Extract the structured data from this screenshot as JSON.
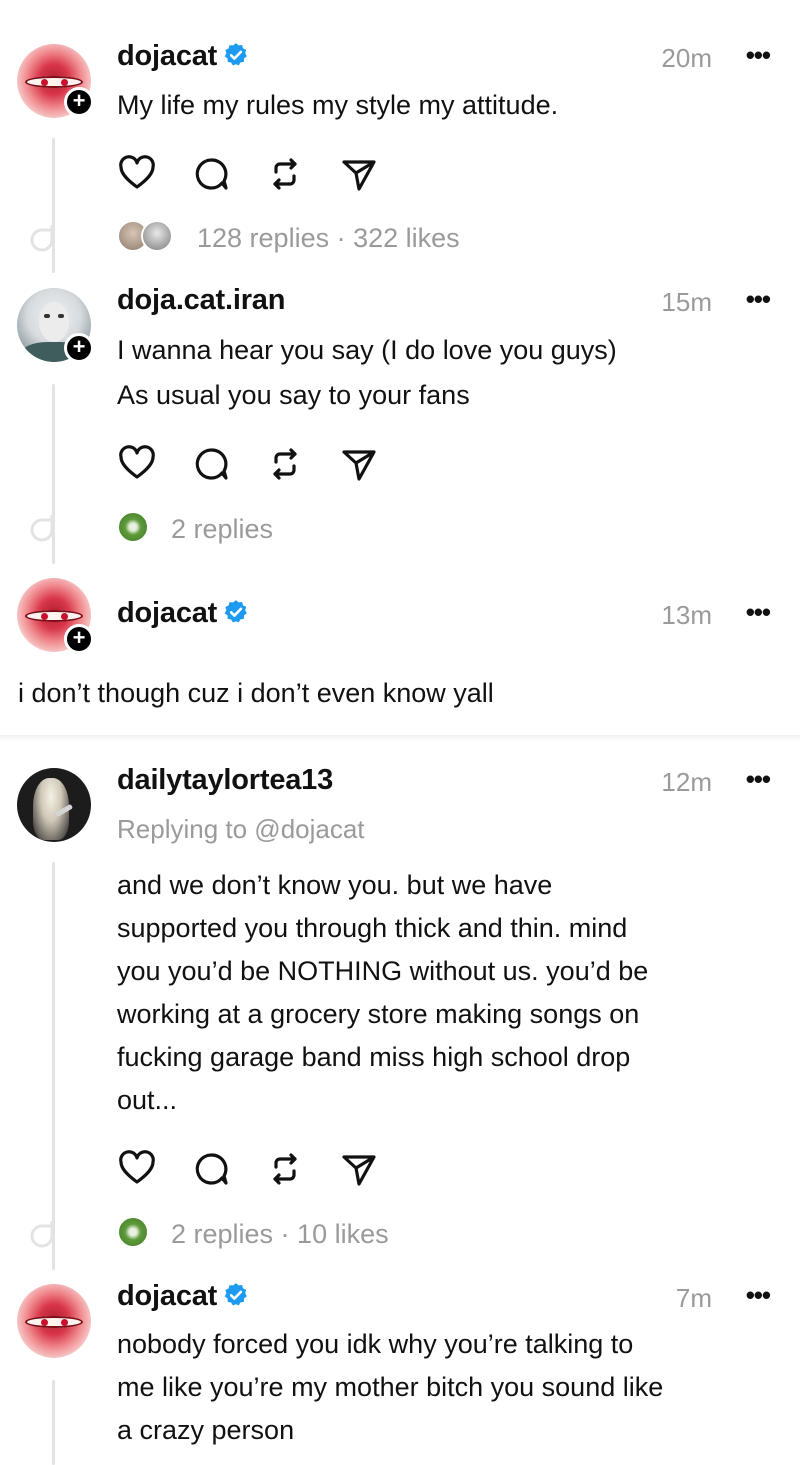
{
  "posts": [
    {
      "username": "dojacat",
      "verified": true,
      "time": "20m",
      "text_lines": [
        "My life my rules my style my attitude."
      ],
      "meta": "128 replies · 322 likes"
    },
    {
      "username": "doja.cat.iran",
      "verified": false,
      "time": "15m",
      "text_lines": [
        "I wanna hear you say (I do love you guys)",
        "As usual you say to your fans"
      ],
      "meta": "2 replies"
    },
    {
      "username": "dojacat",
      "verified": true,
      "time": "13m",
      "text_lines": [
        "i don’t though cuz i don’t even know yall"
      ]
    },
    {
      "username": "dailytaylortea13",
      "verified": false,
      "time": "12m",
      "replying_to": "Replying to @dojacat",
      "text_lines": [
        "and we don’t know you. but we have",
        "supported you through thick and thin. mind",
        "you you’d be NOTHING without us. you’d be",
        "working at a grocery store making songs on",
        "fucking garage band miss high school drop",
        "out..."
      ],
      "meta": "2 replies · 10 likes"
    },
    {
      "username": "dojacat",
      "verified": true,
      "time": "7m",
      "text_lines": [
        "nobody forced you idk why you’re talking to",
        "me like you’re my mother bitch you sound like",
        "a crazy person"
      ]
    }
  ],
  "icons": {
    "more": "•••",
    "plus": "+",
    "verified_color": "#1D9BF0"
  }
}
